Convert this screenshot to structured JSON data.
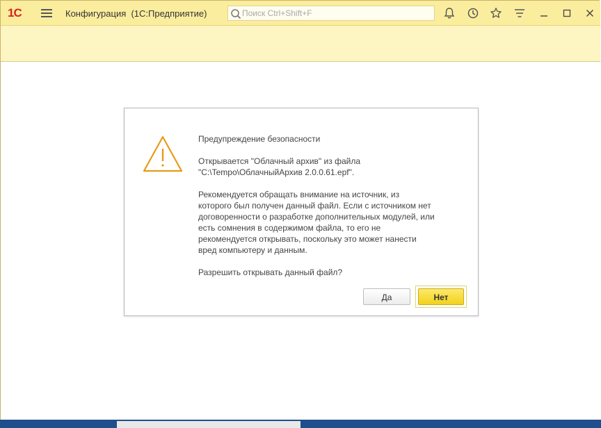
{
  "app": {
    "logo_text": "1С",
    "title": "Конфигурация  (1С:Предприятие)"
  },
  "search": {
    "placeholder": "Поиск Ctrl+Shift+F"
  },
  "toolbar_icons": [
    "bell-icon",
    "history-icon",
    "star-icon",
    "menu-lines-icon",
    "minimize-icon",
    "maximize-icon",
    "close-icon"
  ],
  "dialog": {
    "heading": "Предупреждение безопасности",
    "opening_line1": "Открывается \"Облачный архив\" из файла",
    "opening_line2": "\"C:\\Tempo\\ОблачныйАрхив 2.0.0.61.epf\".",
    "recommendation": [
      "Рекомендуется обращать внимание на источник, из",
      "которого был получен данный файл. Если с источником нет",
      "договоренности о разработке дополнительных модулей, или",
      "есть сомнения в содержимом файла, то его не",
      "рекомендуется открывать, поскольку это может нанести",
      "вред компьютеру и данным."
    ],
    "question": "Разрешить открывать данный файл?",
    "yes_label": "Да",
    "no_label": "Нет"
  },
  "colors": {
    "titlebar": "#fbed9e",
    "subbar": "#fdf5c2",
    "warning": "#e89a1a",
    "primary_button": "#f7dc2e",
    "logo": "#d6261e"
  }
}
